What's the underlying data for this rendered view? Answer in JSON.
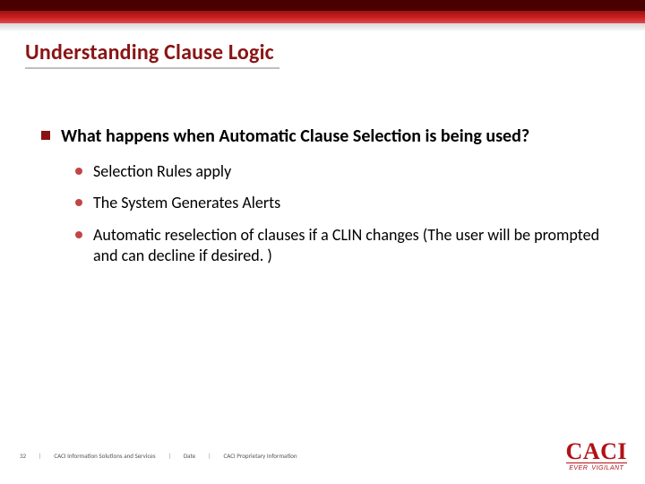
{
  "slide": {
    "title": "Understanding Clause Logic",
    "main_bullet": "What happens when Automatic Clause Selection is being used?",
    "sub_bullets": [
      "Selection Rules apply",
      "The System Generates Alerts",
      "Automatic reselection of clauses if a CLIN changes (The user will be prompted and can decline if desired. )"
    ]
  },
  "footer": {
    "page_number": "32",
    "org": "CACI Information Solutions and Services",
    "date_label": "Date",
    "proprietary": "CACI Proprietary Information",
    "separator": "|"
  },
  "logo": {
    "main": "CACI",
    "tagline_a": "EVER",
    "tagline_b": "VIGILANT"
  },
  "colors": {
    "brand_red": "#8a1414",
    "bullet_red": "#c24545",
    "logo_red": "#b11116"
  }
}
